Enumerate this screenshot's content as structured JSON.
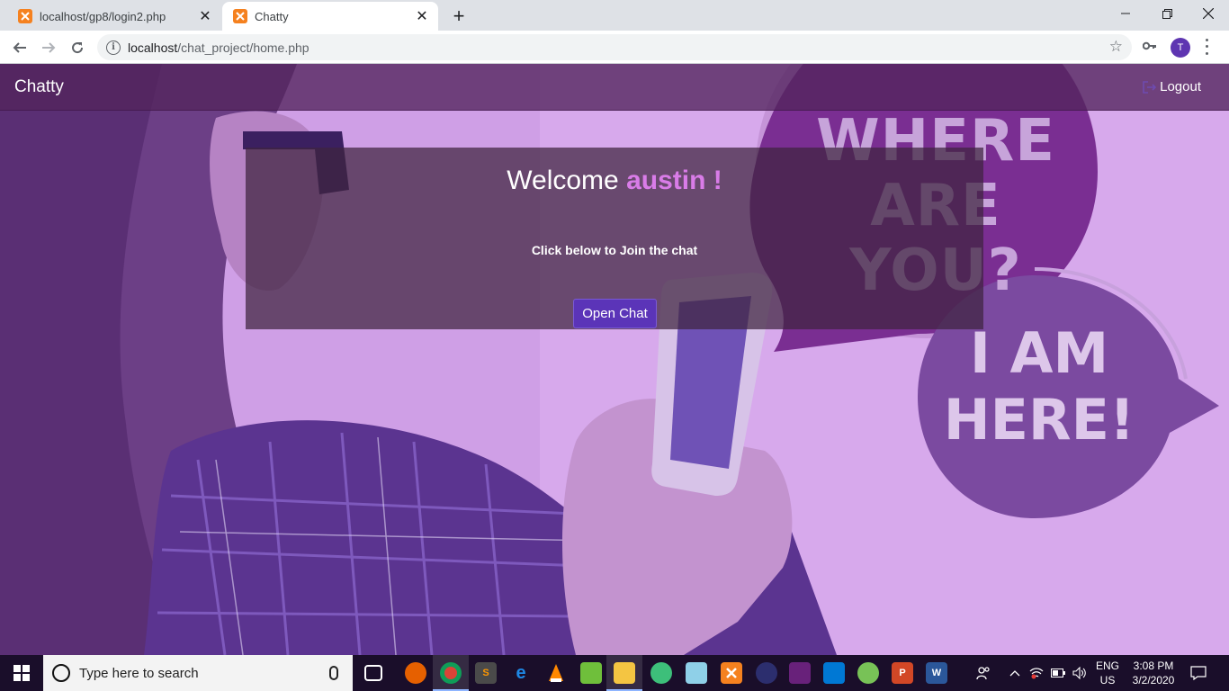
{
  "browser": {
    "tabs": [
      {
        "title": "localhost/gp8/login2.php",
        "active": false
      },
      {
        "title": "Chatty",
        "active": true
      }
    ],
    "url_host": "localhost",
    "url_path": "/chat_project/home.php",
    "profile_initial": "T"
  },
  "page": {
    "brand": "Chatty",
    "logout_label": "Logout",
    "welcome_prefix": "Welcome",
    "username": "austin !",
    "join_text": "Click below to Join the chat",
    "open_chat_label": "Open Chat",
    "bubble_text_1": "WHERE ARE YOU?",
    "bubble_text_2": "I AM HERE!"
  },
  "taskbar": {
    "search_placeholder": "Type here to search",
    "lang_line1": "ENG",
    "lang_line2": "US",
    "time": "3:08 PM",
    "date": "3/2/2020"
  },
  "colors": {
    "navbar": "#52245c",
    "accent_username": "#d97ce8",
    "button": "#5b34b8",
    "background": "#cf9fe6"
  }
}
